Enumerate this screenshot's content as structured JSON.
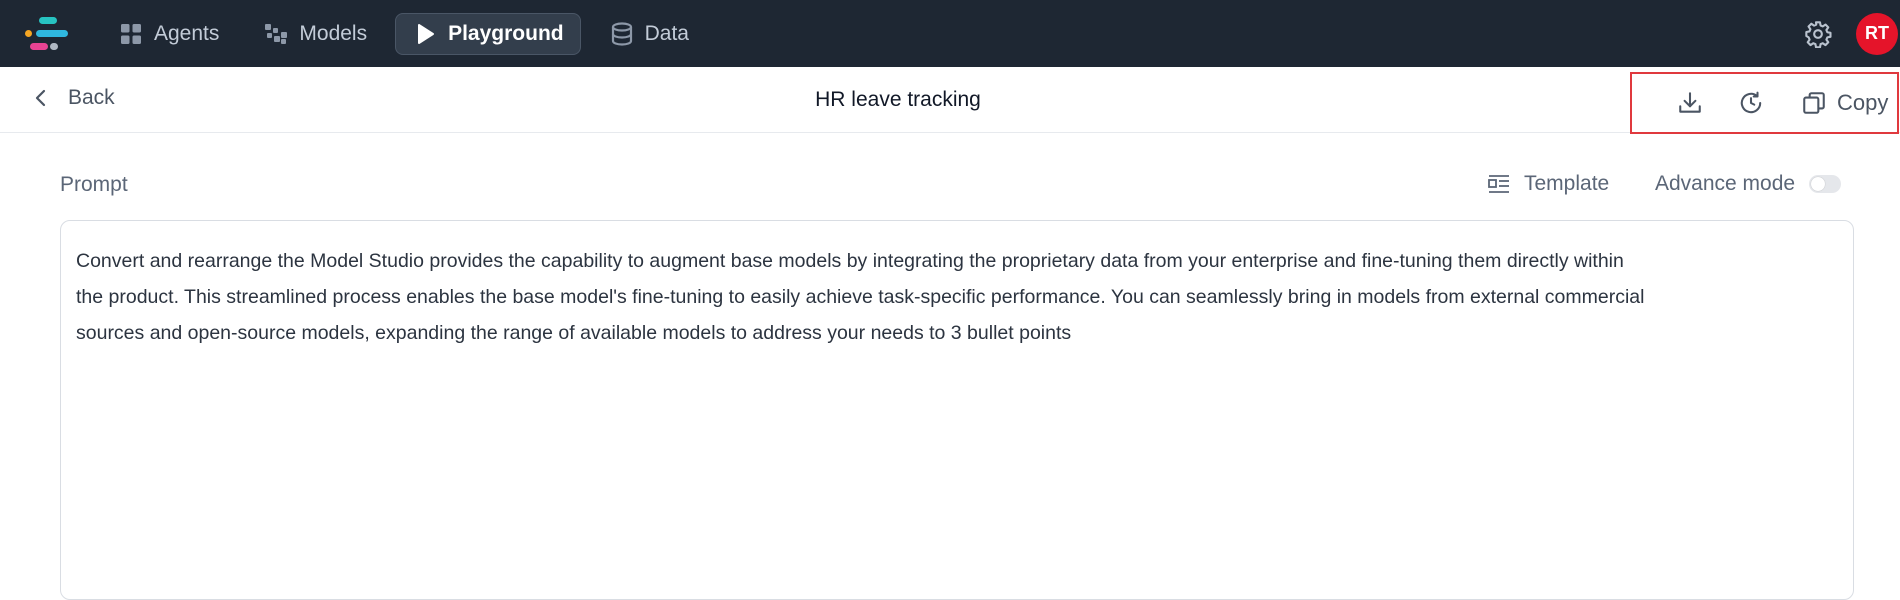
{
  "nav": {
    "items": [
      {
        "label": "Agents",
        "icon": "grid-icon"
      },
      {
        "label": "Models",
        "icon": "models-icon"
      },
      {
        "label": "Playground",
        "icon": "play-icon",
        "active": true
      },
      {
        "label": "Data",
        "icon": "database-icon"
      }
    ],
    "avatar_initials": "RT"
  },
  "subheader": {
    "back_label": "Back",
    "title": "HR leave tracking",
    "copy_label": "Copy"
  },
  "prompt": {
    "label": "Prompt",
    "template_label": "Template",
    "advance_mode_label": "Advance mode",
    "advance_mode_on": false,
    "text_lines": [
      "Convert and rearrange the Model Studio provides the capability to augment base models by integrating the proprietary data from your enterprise and fine-tuning them directly within",
      "the product. This streamlined process enables the base model's fine-tuning to easily achieve task-specific performance. You can seamlessly bring in models from external commercial",
      "sources and open-source models, expanding the range of available models to address your needs to 3 bullet points"
    ]
  },
  "colors": {
    "topbar_bg": "#1e2733",
    "avatar_bg": "#e5142a",
    "highlight_border": "#e0393e"
  }
}
